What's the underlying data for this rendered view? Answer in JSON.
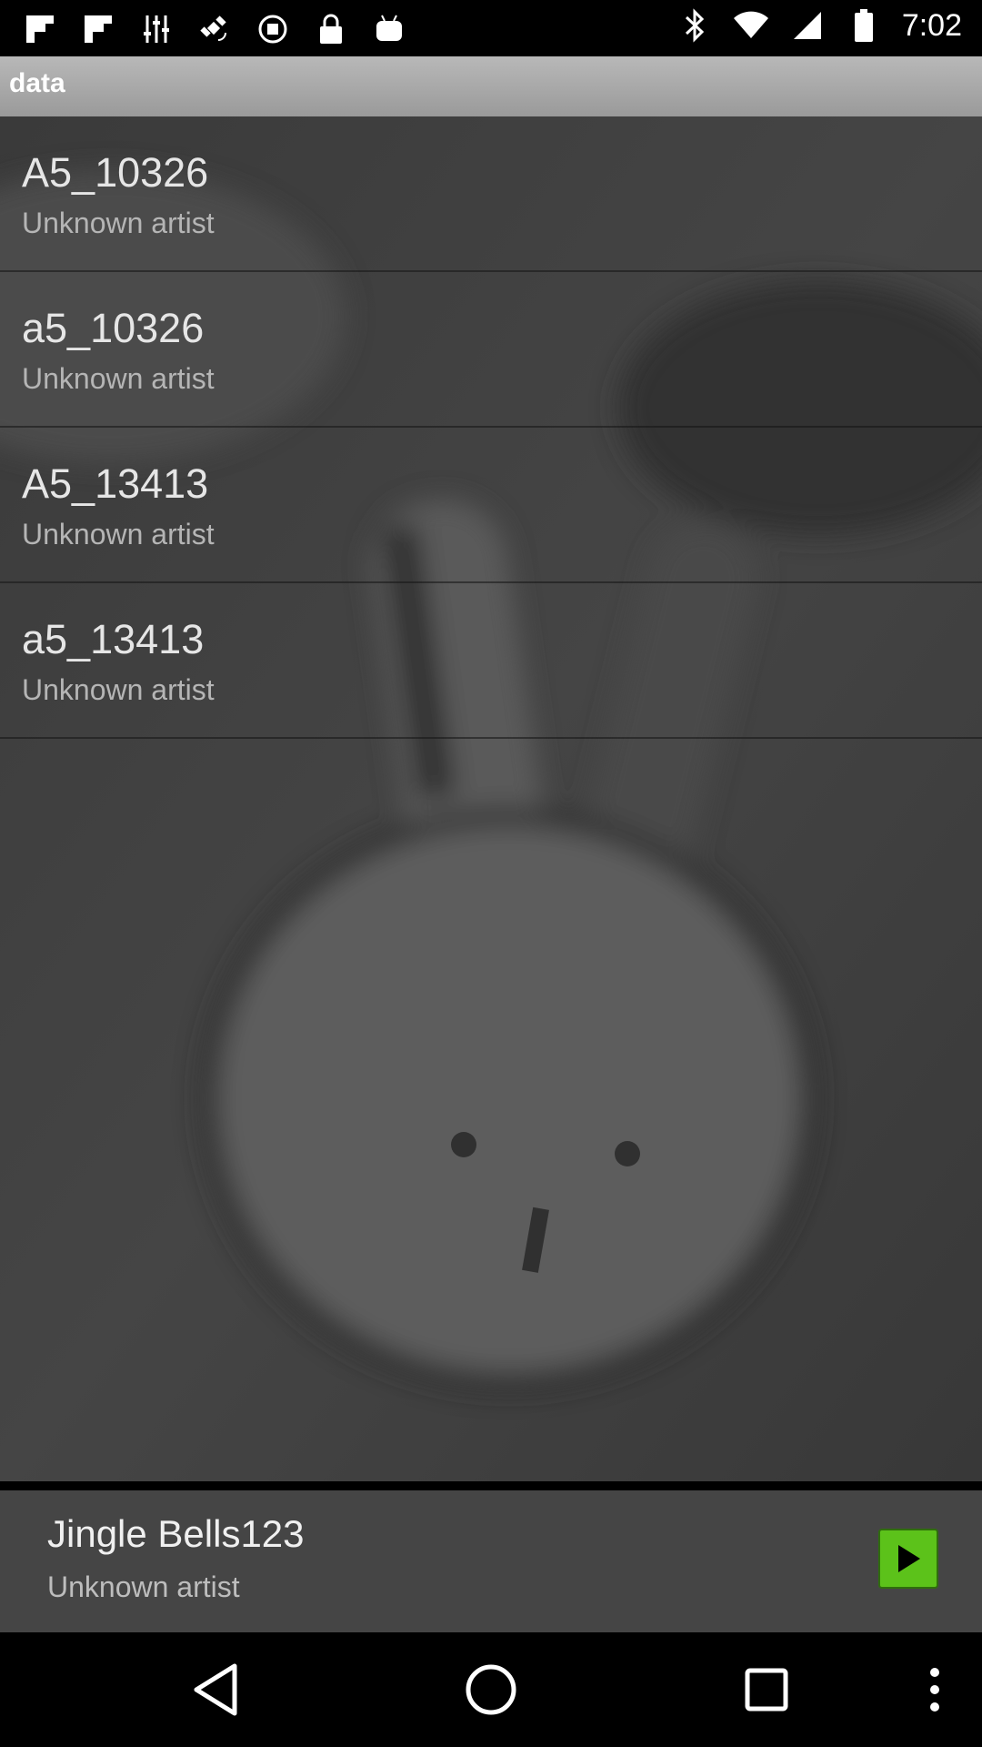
{
  "status_bar": {
    "time": "7:02",
    "left_icons": [
      "flipboard-icon",
      "flipboard-icon",
      "equalizer-icon",
      "satellite-icon",
      "blocked-icon",
      "lock-icon",
      "android-icon"
    ],
    "right_icons": [
      "bluetooth-icon",
      "wifi-icon",
      "signal-icon",
      "battery-icon"
    ]
  },
  "header": {
    "title": "data"
  },
  "songs": [
    {
      "title": "A5_10326",
      "artist": "Unknown artist"
    },
    {
      "title": "a5_10326",
      "artist": "Unknown artist"
    },
    {
      "title": "A5_13413",
      "artist": "Unknown artist"
    },
    {
      "title": "a5_13413",
      "artist": "Unknown artist"
    }
  ],
  "now_playing": {
    "title": "Jingle Bells123",
    "artist": "Unknown artist",
    "play_icon": "play-icon"
  },
  "nav_bar": {
    "icons": [
      "back-icon",
      "home-icon",
      "recents-icon",
      "more-icon"
    ]
  },
  "colors": {
    "accent_play": "#5cc21a",
    "header": "#a8a8a8",
    "background": "#3f3f3f"
  }
}
